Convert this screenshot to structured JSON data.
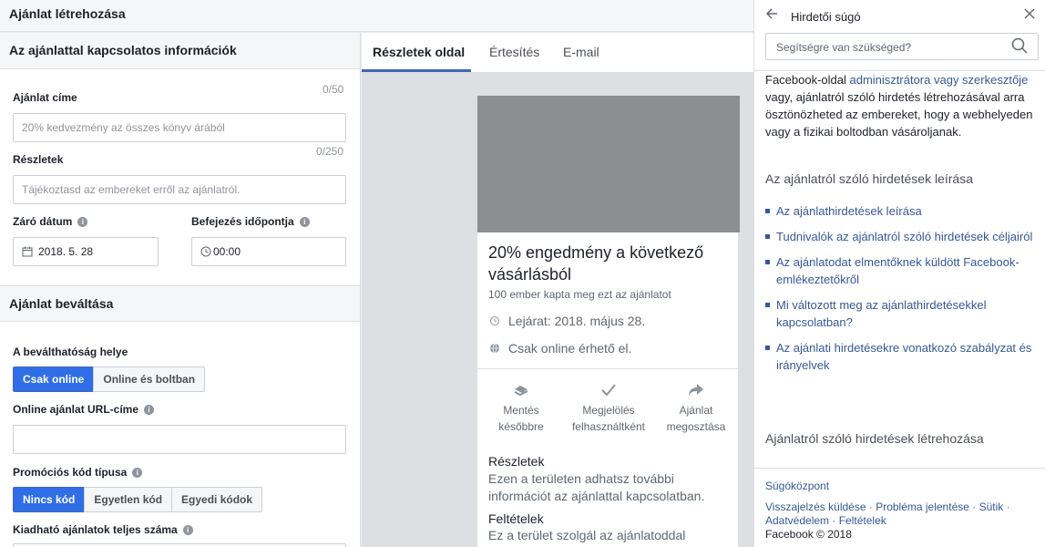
{
  "page_title": "Ajánlat létrehozása",
  "form": {
    "section1_title": "Az ajánlattal kapcsolatos információk",
    "offer_title_label": "Ajánlat címe",
    "offer_title_counter": "0/50",
    "offer_title_placeholder": "20% kedvezmény az összes könyv árából",
    "details_counter": "0/250",
    "details_label": "Részletek",
    "details_placeholder": "Tájékoztasd az embereket erről az ajánlatról.",
    "end_date_label": "Záró dátum",
    "end_date_value": "2018. 5. 28",
    "end_time_label": "Befejezés időpontja",
    "end_time_value": "00:00",
    "section2_title": "Ajánlat beváltása",
    "redeem_location_label": "A beválthatóság helye",
    "redeem_options": [
      "Csak online",
      "Online és boltban"
    ],
    "redeem_selected": "Csak online",
    "url_label": "Online ajánlat URL-címe",
    "url_value": "",
    "promo_type_label": "Promóciós kód típusa",
    "promo_options": [
      "Nincs kód",
      "Egyetlen kód",
      "Egyedi kódok"
    ],
    "promo_selected": "Nincs kód",
    "total_label": "Kiadható ajánlatok teljes száma"
  },
  "preview": {
    "tabs": [
      "Részletek oldal",
      "Értesítés",
      "E-mail"
    ],
    "active_tab": "Részletek oldal",
    "offer_title": "20% engedmény a következő vásárlásból",
    "claimed": "100 ember kapta meg ezt az ajánlatot",
    "expiry": "Lejárat: 2018. május 28.",
    "availability": "Csak online érhető el.",
    "actions": [
      {
        "line1": "Mentés",
        "line2": "későbbre"
      },
      {
        "line1": "Megjelölés",
        "line2": "felhasználtként"
      },
      {
        "line1": "Ajánlat",
        "line2": "megosztása"
      }
    ],
    "details_heading": "Részletek",
    "details_text": "Ezen a területen adhatsz további információt az ajánlattal kapcsolatban.",
    "terms_heading": "Feltételek",
    "terms_text": "Ez a terület szolgál az ajánlatoddal kapcsolatos feltételek ismertetésére."
  },
  "help": {
    "title": "Hirdetői súgó",
    "search_placeholder": "Segítségre van szükséged?",
    "intro_pre": "Facebook-oldal ",
    "intro_link": "adminisztrátora vagy szerkesztője",
    "intro_post": " vagy, ajánlatról szóló hirdetés létrehozásával arra ösztönözheted az embereket, hogy a webhelyeden vagy a fizikai boltodban vásároljanak.",
    "section_title": "Az ajánlatról szóló hirdetések leírása",
    "links": [
      "Az ajánlathirdetések leírása",
      "Tudnivalók az ajánlatról szóló hirdetések céljairól",
      "Az ajánlatodat elmentőknek küldött Facebook-emlékeztetőkről",
      "Mi változott meg az ajánlathirdetésekkel kapcsolatban?",
      "Az ajánlati hirdetésekre vonatkozó szabályzat és irányelvek"
    ],
    "section2_title": "Ajánlatról szóló hirdetések létrehozása",
    "footer_center": "Súgóközpont",
    "footer_links": [
      "Visszajelzés küldése",
      "Probléma jelentése",
      "Sütik",
      "Adatvédelem",
      "Feltételek"
    ],
    "copyright": "Facebook © 2018"
  },
  "colors": {
    "accent": "#4267b2",
    "link": "#365899",
    "segment_active": "#2f6ee7"
  },
  "icons": [
    "calendar-icon",
    "clock-icon",
    "info-icon",
    "back-arrow-icon",
    "close-icon",
    "search-icon",
    "save-icon",
    "check-icon",
    "share-icon",
    "globe-icon"
  ]
}
